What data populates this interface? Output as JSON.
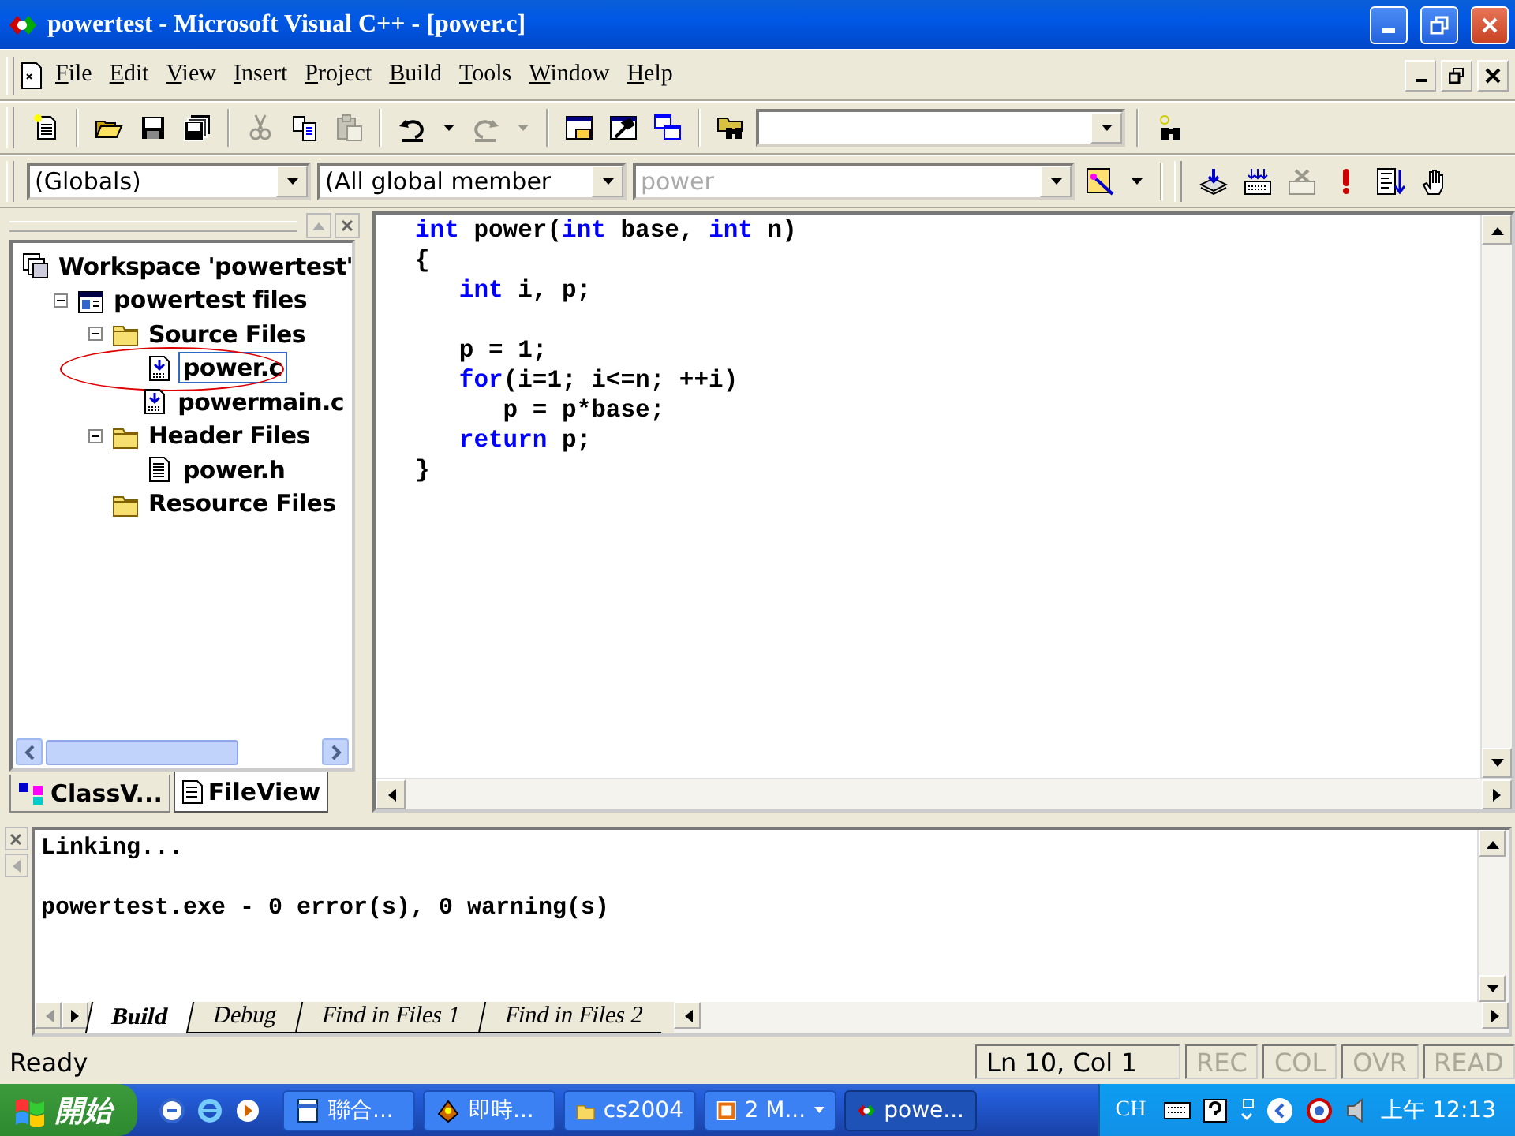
{
  "window": {
    "title": "powertest - Microsoft Visual C++ - [power.c]"
  },
  "menu": [
    "File",
    "Edit",
    "View",
    "Insert",
    "Project",
    "Build",
    "Tools",
    "Window",
    "Help"
  ],
  "toolbar": {
    "items": [
      {
        "kind": "new",
        "disabled": false
      },
      {
        "kind": "sep"
      },
      {
        "kind": "open",
        "disabled": false
      },
      {
        "kind": "save",
        "disabled": false
      },
      {
        "kind": "saveall",
        "disabled": false
      },
      {
        "kind": "sep"
      },
      {
        "kind": "cut",
        "disabled": true
      },
      {
        "kind": "copy",
        "disabled": false
      },
      {
        "kind": "paste",
        "disabled": true
      },
      {
        "kind": "sep"
      },
      {
        "kind": "undo",
        "disabled": false
      },
      {
        "kind": "drop",
        "disabled": false
      },
      {
        "kind": "redo",
        "disabled": true
      },
      {
        "kind": "drop",
        "disabled": true
      },
      {
        "kind": "sep"
      },
      {
        "kind": "workspace",
        "disabled": false
      },
      {
        "kind": "output",
        "disabled": false
      },
      {
        "kind": "windows",
        "disabled": false
      },
      {
        "kind": "sep"
      },
      {
        "kind": "findfiles",
        "disabled": false
      },
      {
        "kind": "findcombo"
      },
      {
        "kind": "sep"
      },
      {
        "kind": "find",
        "disabled": false
      }
    ]
  },
  "wizard_bar": {
    "class_combo": "(Globals)",
    "filter_combo": "(All global member",
    "function_combo": "power",
    "items": [
      {
        "kind": "wizard",
        "disabled": false
      },
      {
        "kind": "drop",
        "disabled": false
      },
      {
        "kind": "grip"
      },
      {
        "kind": "compile",
        "disabled": false
      },
      {
        "kind": "build",
        "disabled": false
      },
      {
        "kind": "stopbuild",
        "disabled": true
      },
      {
        "kind": "execute",
        "disabled": false
      },
      {
        "kind": "go",
        "disabled": false
      },
      {
        "kind": "breakpoint",
        "disabled": false
      }
    ]
  },
  "workspace": {
    "tree": [
      {
        "label": "Workspace 'powertest'",
        "kind": "workspace",
        "selected": false,
        "circled": false,
        "children": [
          {
            "label": "powertest files",
            "kind": "project",
            "expanded": true,
            "selected": false,
            "circled": false,
            "children": [
              {
                "label": "Source Files",
                "kind": "folder",
                "expanded": true,
                "selected": false,
                "circled": false,
                "children": [
                  {
                    "label": "power.c",
                    "kind": "source",
                    "selected": true,
                    "circled": true
                  },
                  {
                    "label": "powermain.c",
                    "kind": "source",
                    "selected": false,
                    "circled": false
                  }
                ]
              },
              {
                "label": "Header Files",
                "kind": "folder",
                "expanded": true,
                "selected": false,
                "circled": false,
                "children": [
                  {
                    "label": "power.h",
                    "kind": "header",
                    "selected": false,
                    "circled": false
                  }
                ]
              },
              {
                "label": "Resource Files",
                "kind": "folder",
                "selected": false,
                "circled": false
              }
            ]
          }
        ]
      }
    ],
    "tabs": [
      {
        "label": "ClassV...",
        "kind": "class",
        "selected": false
      },
      {
        "label": "FileView",
        "kind": "file",
        "selected": true
      }
    ]
  },
  "editor": {
    "blocks": [
      [
        {
          "tokens": [
            {
              "text": "int",
              "kind": "keyword"
            },
            {
              "text": " power(",
              "kind": "plain"
            },
            {
              "text": "int",
              "kind": "keyword"
            },
            {
              "text": " base, ",
              "kind": "plain"
            },
            {
              "text": "int",
              "kind": "keyword"
            },
            {
              "text": " n)",
              "kind": "plain"
            }
          ]
        },
        {
          "tokens": [
            {
              "text": "{",
              "kind": "plain"
            }
          ]
        },
        {
          "tokens": [
            {
              "text": "   int",
              "kind": "keyword"
            },
            {
              "text": " i, p;",
              "kind": "plain"
            }
          ]
        }
      ],
      [
        {
          "tokens": [
            {
              "text": "   p = 1;",
              "kind": "plain"
            }
          ]
        },
        {
          "tokens": [
            {
              "text": "   for",
              "kind": "keyword"
            },
            {
              "text": "(i=1; i<=n; ++i)",
              "kind": "plain"
            }
          ]
        },
        {
          "tokens": [
            {
              "text": "      p = p*base;",
              "kind": "plain"
            }
          ]
        },
        {
          "tokens": [
            {
              "text": "   return",
              "kind": "keyword"
            },
            {
              "text": " p;",
              "kind": "plain"
            }
          ]
        },
        {
          "tokens": [
            {
              "text": "}",
              "kind": "plain"
            }
          ]
        }
      ]
    ]
  },
  "output": {
    "blocks": [
      [
        "Linking..."
      ],
      [
        "powertest.exe - 0 error(s), 0 warning(s)"
      ]
    ],
    "tabs": [
      {
        "label": "Build",
        "selected": true
      },
      {
        "label": "Debug",
        "selected": false
      },
      {
        "label": "Find in Files 1",
        "selected": false
      },
      {
        "label": "Find in Files 2",
        "selected": false
      }
    ]
  },
  "status_bar": {
    "message": "Ready",
    "position": "Ln 10, Col 1",
    "indicators": [
      {
        "label": "REC",
        "on": false
      },
      {
        "label": "COL",
        "on": false
      },
      {
        "label": "OVR",
        "on": false
      },
      {
        "label": "READ",
        "on": false
      }
    ]
  },
  "taskbar": {
    "start": "開始",
    "tasks": [
      {
        "label": "聯合...",
        "kind": "doc",
        "selected": false
      },
      {
        "label": "即時...",
        "kind": "chat",
        "selected": false
      },
      {
        "label": "cs2004",
        "kind": "folder",
        "selected": false
      },
      {
        "label": "2 M...",
        "kind": "slides",
        "selected": false,
        "group": true
      },
      {
        "label": "powe...",
        "kind": "ide",
        "selected": true
      }
    ],
    "language": "CH",
    "clock": "上午 12:13"
  }
}
